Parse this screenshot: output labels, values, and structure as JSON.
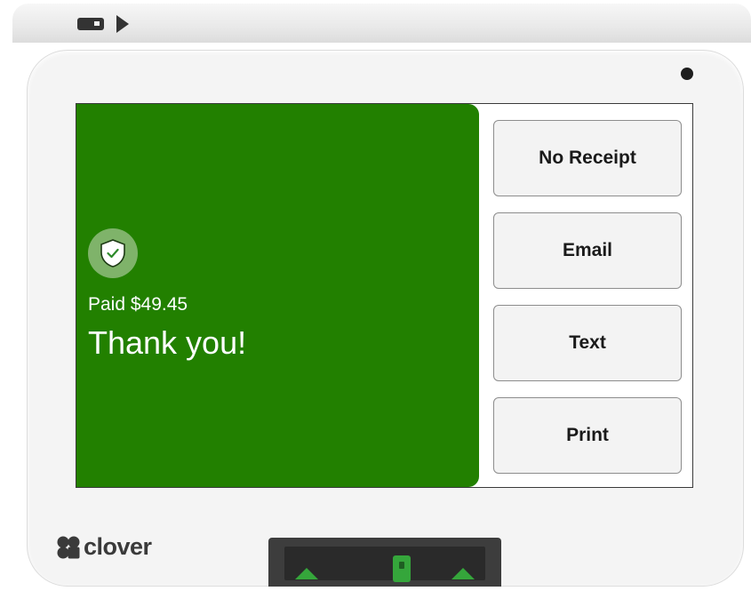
{
  "colors": {
    "success_green": "#228000",
    "shield_circle": "#7fb36a",
    "button_bg": "#f3f3f3",
    "accent_green": "#35a63b"
  },
  "payment": {
    "icon": "shield-check-icon",
    "paid_label": "Paid $49.45",
    "message": "Thank you!"
  },
  "receipt_options": [
    {
      "label": "No Receipt"
    },
    {
      "label": "Email"
    },
    {
      "label": "Text"
    },
    {
      "label": "Print"
    }
  ],
  "device": {
    "brand": "clover",
    "brand_icon": "clover-logo-icon",
    "card_slot_icon": "card-insert-icon",
    "reader_icon": "card-chip-icon"
  }
}
